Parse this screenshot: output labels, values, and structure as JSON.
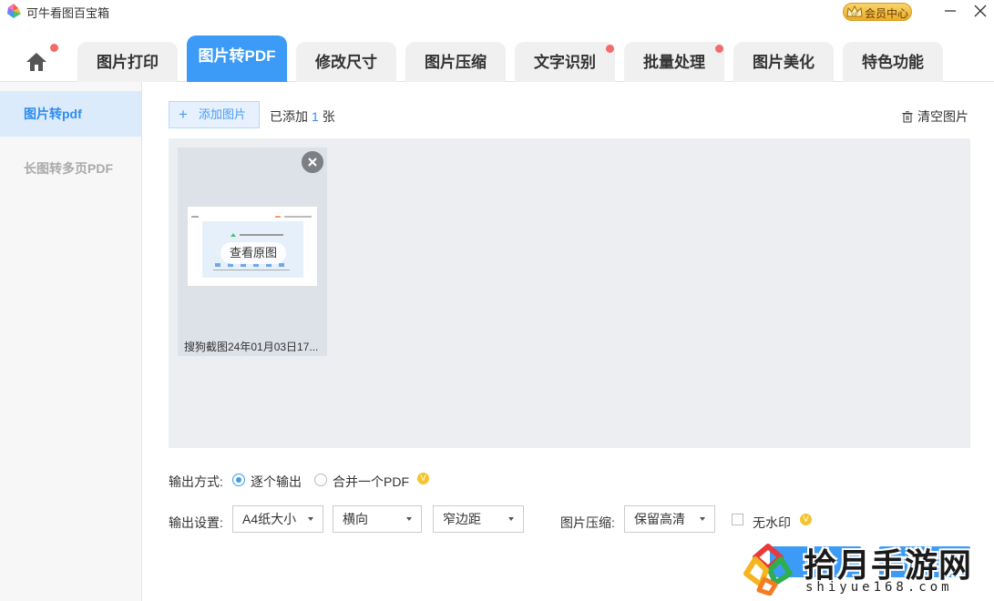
{
  "app": {
    "title": "可牛看图百宝箱",
    "vip_label": "会员中心"
  },
  "tabs": [
    {
      "label": "图片打印"
    },
    {
      "label": "图片转PDF"
    },
    {
      "label": "修改尺寸"
    },
    {
      "label": "图片压缩"
    },
    {
      "label": "文字识别"
    },
    {
      "label": "批量处理"
    },
    {
      "label": "图片美化"
    },
    {
      "label": "特色功能"
    }
  ],
  "sidebar": {
    "items": [
      {
        "label": "图片转pdf"
      },
      {
        "label": "长图转多页PDF"
      }
    ]
  },
  "main": {
    "add_button": "添加图片",
    "added_prefix": "已添加",
    "added_count": "1",
    "added_suffix": "张",
    "clear_button": "清空图片",
    "thumb": {
      "view_label": "查看原图",
      "file_name": "搜狗截图24年01月03日17..."
    }
  },
  "output": {
    "mode_label": "输出方式:",
    "mode_options": [
      {
        "label": "逐个输出",
        "selected": true
      },
      {
        "label": "合并一个PDF",
        "selected": false
      }
    ],
    "settings_label": "输出设置:",
    "paper_size": "A4纸大小",
    "orientation": "横向",
    "margin": "窄边距",
    "compress_label": "图片压缩:",
    "compress_value": "保留高清",
    "watermark_label": "无水印",
    "vip_badge": "V"
  },
  "buttons": {
    "preview": "预览",
    "start": "开始转换"
  },
  "watermark": {
    "text": "拾月手游网",
    "url": "shiyue168.com"
  },
  "colors": {
    "accent": "#3b9bf6",
    "dot": "#f26c6c",
    "vip": "#f4c430"
  }
}
